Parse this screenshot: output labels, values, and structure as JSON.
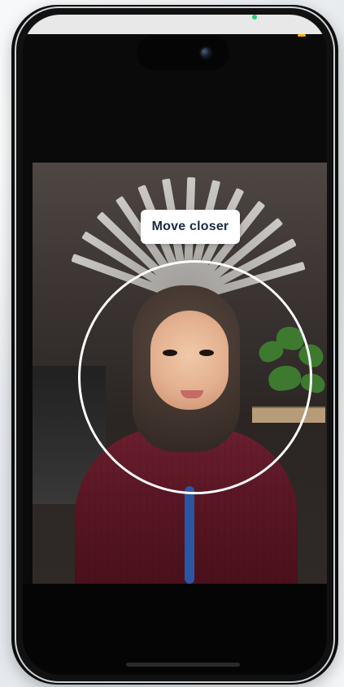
{
  "screen": {
    "hint_text": "Move closer"
  },
  "icons": {
    "camera": "front-camera-icon"
  },
  "colors": {
    "ring": "#ffffff",
    "hint_bg": "#ffffff",
    "hint_text": "#1a2a44",
    "recording_dot": "#2ecc71",
    "status_accent": "#f7b500"
  }
}
